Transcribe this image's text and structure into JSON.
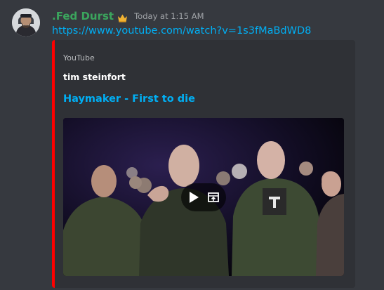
{
  "message": {
    "author": {
      "name": ".Fed Durst",
      "name_color": "#3ba55d",
      "badge_icon": "crown-icon"
    },
    "timestamp": "Today at 1:15 AM",
    "link_text": "https://www.youtube.com/watch?v=1s3fMaBdWD8"
  },
  "embed": {
    "accent_color": "#ff0000",
    "provider": "YouTube",
    "author": "tim steinfort",
    "title": "Haymaker - First to die",
    "video": {
      "play_icon": "play-icon",
      "open_icon": "open-external-icon"
    }
  }
}
